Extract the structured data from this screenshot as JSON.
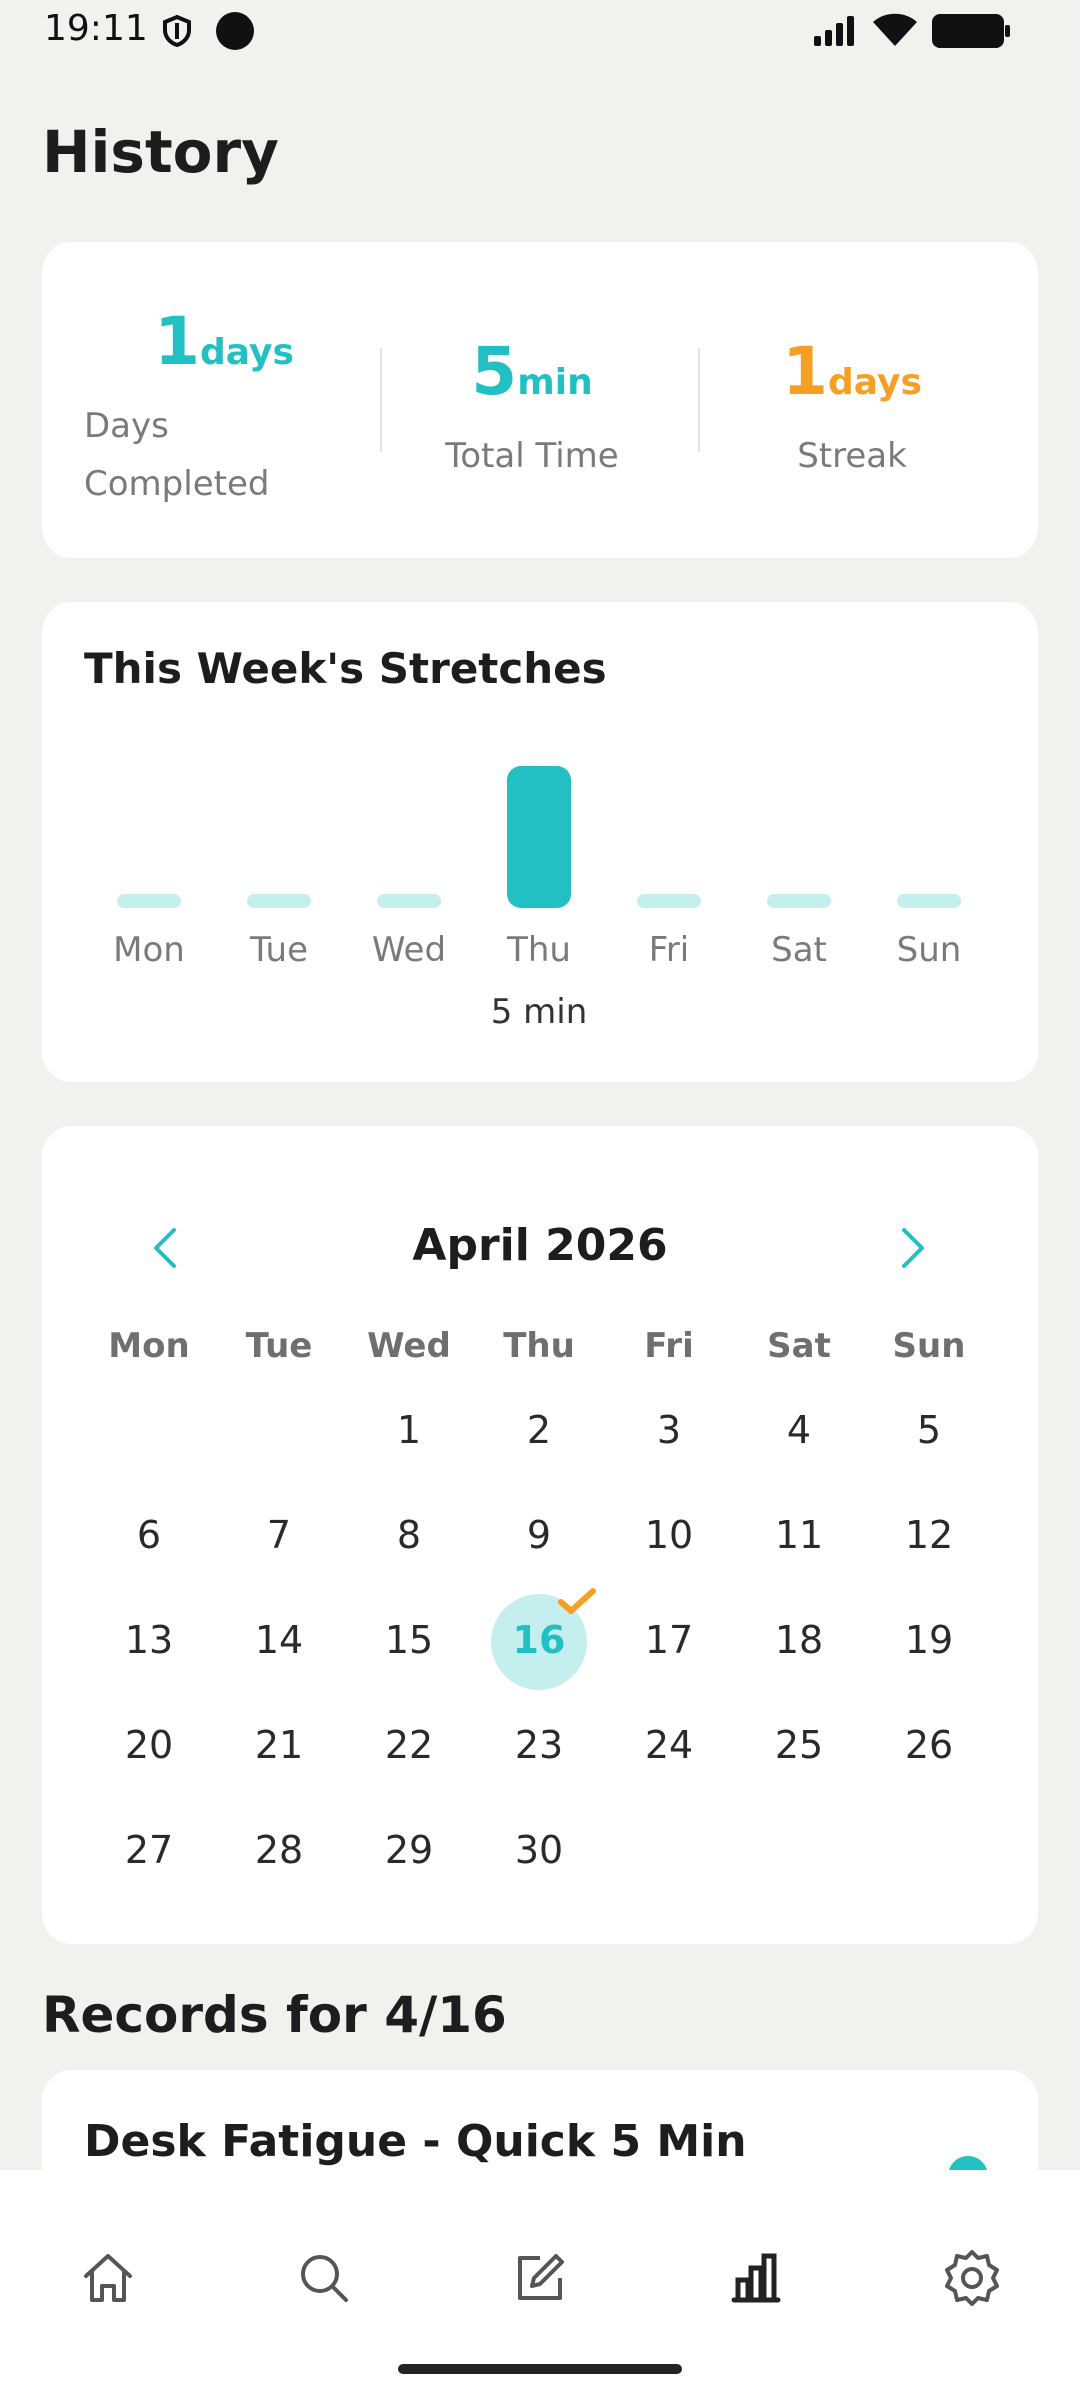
{
  "status_bar": {
    "time": "19:11"
  },
  "header": {
    "title": "History"
  },
  "summary": {
    "days_completed": {
      "value": "1",
      "unit": "days",
      "label_line1": "Days",
      "label_line2": "Completed"
    },
    "total_time": {
      "value": "5",
      "unit": "min",
      "label": "Total Time"
    },
    "streak": {
      "value": "1",
      "unit": "days",
      "label": "Streak"
    }
  },
  "week_chart": {
    "title": "This Week's Stretches",
    "days": [
      "Mon",
      "Tue",
      "Wed",
      "Thu",
      "Fri",
      "Sat",
      "Sun"
    ],
    "values_min": [
      0,
      0,
      0,
      5,
      0,
      0,
      0
    ],
    "highlight_label": "5 min",
    "colors": {
      "active": "#22bfc3",
      "inactive": "#c5eeee"
    }
  },
  "calendar": {
    "month_title": "April 2026",
    "weekdays": [
      "Mon",
      "Tue",
      "Wed",
      "Thu",
      "Fri",
      "Sat",
      "Sun"
    ],
    "weeks": [
      [
        "",
        "",
        "1",
        "2",
        "3",
        "4",
        "5"
      ],
      [
        "6",
        "7",
        "8",
        "9",
        "10",
        "11",
        "12"
      ],
      [
        "13",
        "14",
        "15",
        "16",
        "17",
        "18",
        "19"
      ],
      [
        "20",
        "21",
        "22",
        "23",
        "24",
        "25",
        "26"
      ],
      [
        "27",
        "28",
        "29",
        "30",
        "",
        "",
        ""
      ]
    ],
    "selected_day": "16",
    "completed_days": [
      "16"
    ]
  },
  "records": {
    "title": "Records for 4/16",
    "items": [
      {
        "title": "Desk Fatigue - Quick 5 Min"
      }
    ]
  },
  "nav": {
    "items": [
      {
        "name": "home",
        "icon": "home-icon"
      },
      {
        "name": "search",
        "icon": "search-icon"
      },
      {
        "name": "edit",
        "icon": "edit-icon"
      },
      {
        "name": "history",
        "icon": "bar-chart-icon",
        "active": true
      },
      {
        "name": "settings",
        "icon": "gear-icon"
      }
    ]
  },
  "colors": {
    "accent": "#22bfc3",
    "streak": "#f5a024",
    "background": "#f1f1ee"
  }
}
